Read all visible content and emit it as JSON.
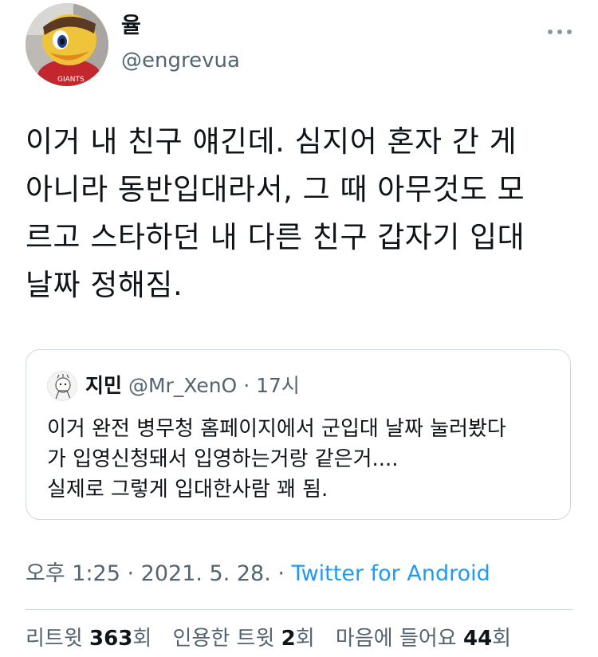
{
  "author": {
    "name": "율",
    "handle": "@engrevua"
  },
  "tweet": {
    "text": "이거 내 친구 얘긴데. 심지어 혼자 간 게\n아니라 동반입대라서, 그 때 아무것도 모\n르고 스타하던 내 다른 친구 갑자기 입대\n날짜 정해짐."
  },
  "quote": {
    "name": "지민",
    "handle": "@Mr_XenO",
    "separator": "·",
    "time": "17시",
    "text": "이거 완전 병무청 홈페이지에서 군입대 날짜 눌러봤다\n가 입영신청돼서 입영하는거랑 같은거....\n실제로 그렇게 입대한사람 꽤 됨."
  },
  "meta": {
    "time": "오후 1:25",
    "sep1": " · ",
    "date": "2021. 5. 28.",
    "sep2": " · ",
    "source": "Twitter for Android"
  },
  "stats": {
    "retweets_label": "리트윗",
    "retweets_count": "363",
    "retweets_unit": "회",
    "quotes_label": "인용한 트윗",
    "quotes_count": "2",
    "quotes_unit": "회",
    "likes_label": "마음에 들어요",
    "likes_count": "44",
    "likes_unit": "회"
  },
  "icons": {
    "more": "more-horizontal-icon",
    "author_avatar": "avatar-mascot",
    "quote_avatar": "avatar-character"
  }
}
